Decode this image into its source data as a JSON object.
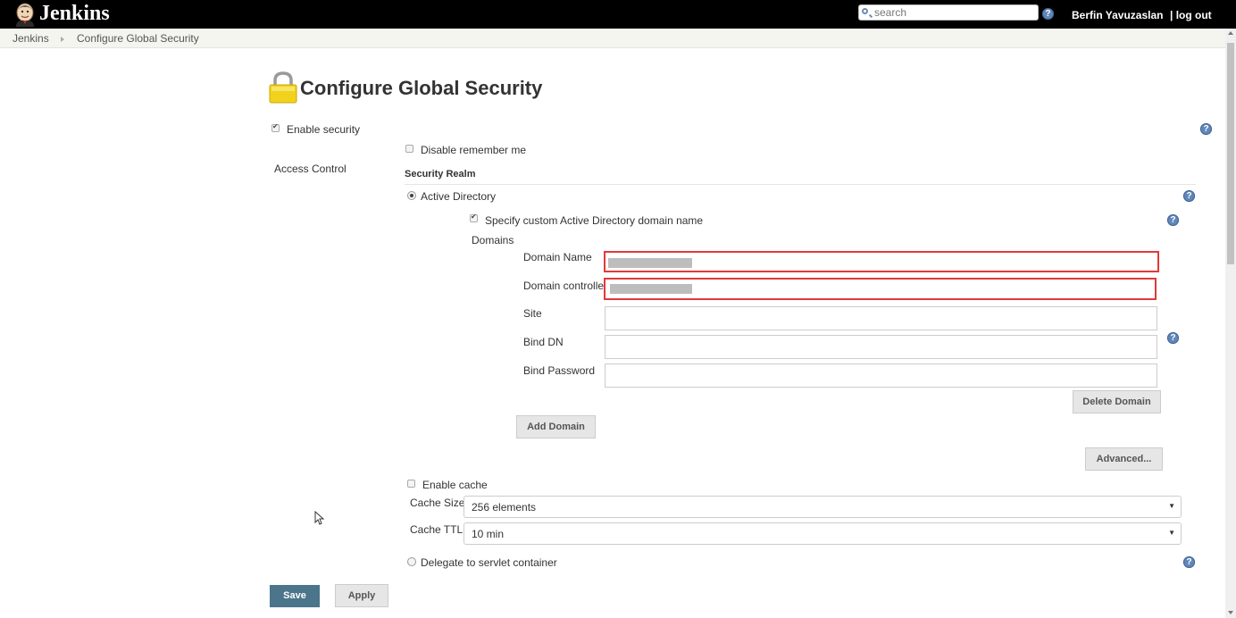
{
  "header": {
    "app_name": "Jenkins",
    "search_placeholder": "search",
    "help_glyph": "?",
    "user_name": "Berfin Yavuzaslan",
    "logout_label": "| log out"
  },
  "breadcrumb": [
    "Jenkins",
    "Configure Global Security"
  ],
  "page": {
    "title": "Configure Global Security",
    "enable_security_label": "Enable security",
    "enable_security_checked": true,
    "disable_remember_me_label": "Disable remember me",
    "disable_remember_me_checked": false,
    "access_control_label": "Access Control",
    "security_realm_label": "Security Realm",
    "active_directory_label": "Active Directory",
    "active_directory_selected": true,
    "custom_domain_label": "Specify custom Active Directory domain name",
    "custom_domain_checked": true,
    "domains_label": "Domains",
    "fields": {
      "domain_name_label": "Domain Name",
      "domain_controller_label": "Domain controller",
      "site_label": "Site",
      "bind_dn_label": "Bind DN",
      "bind_password_label": "Bind Password",
      "domain_name_value": "",
      "domain_controller_value": "",
      "site_value": "",
      "bind_dn_value": "",
      "bind_password_value": ""
    },
    "delete_domain_label": "Delete Domain",
    "add_domain_label": "Add Domain",
    "advanced_label": "Advanced...",
    "enable_cache_label": "Enable cache",
    "enable_cache_checked": false,
    "cache_size_label": "Cache Size",
    "cache_size_value": "256 elements",
    "cache_ttl_label": "Cache TTL",
    "cache_ttl_value": "10 min",
    "delegate_label": "Delegate to servlet container",
    "delegate_selected": false,
    "save_label": "Save",
    "apply_label": "Apply"
  },
  "colors": {
    "header_bg": "#000000",
    "save_bg": "#4b758b",
    "error_border": "#e03a3a",
    "help_icon": "#6187b8"
  }
}
